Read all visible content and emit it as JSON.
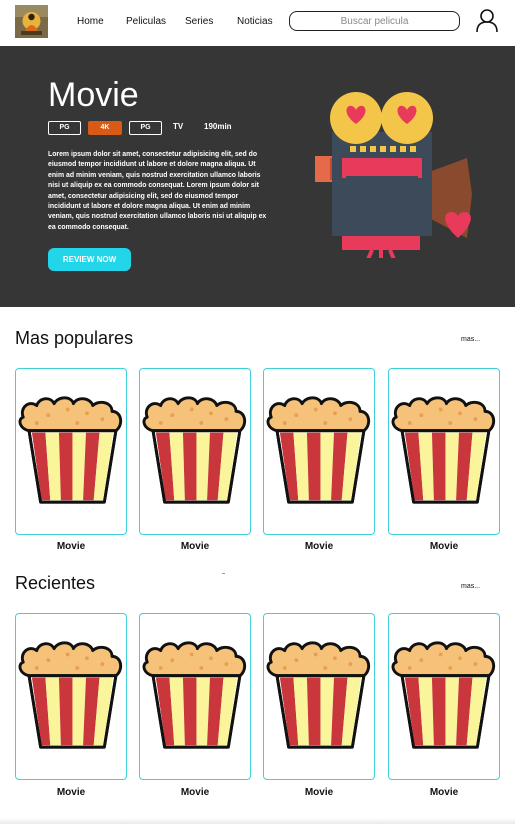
{
  "nav": {
    "links": [
      "Home",
      "Peliculas",
      "Series",
      "Noticias"
    ],
    "search_placeholder": "Buscar pelicula"
  },
  "hero": {
    "title": "Movie",
    "badges": [
      "PG",
      "4K",
      "PG"
    ],
    "type": "TV",
    "duration": "190min",
    "description": "Lorem ipsum dolor sit amet, consectetur adipisicing elit, sed do eiusmod tempor incididunt ut labore et dolore magna aliqua. Ut enim ad minim veniam, quis nostrud exercitation ullamco laboris nisi ut aliquip ex ea commodo consequat. Lorem ipsum dolor sit amet, consectetur adipisicing elit, sed do eiusmod tempor incididunt ut labore et dolore magna aliqua. Ut enim ad minim veniam, quis nostrud exercitation ullamco laboris nisi ut aliquip ex ea commodo consequat.",
    "review_button": "REVIEW NOW"
  },
  "popular": {
    "title": "Mas populares",
    "more": "mas...",
    "items": [
      "Movie",
      "Movie",
      "Movie",
      "Movie"
    ]
  },
  "recent": {
    "title": "Recientes",
    "more": "mas...",
    "items": [
      "Movie",
      "Movie",
      "Movie",
      "Movie"
    ]
  },
  "icons": {
    "logo": "buddha-logo-icon",
    "user": "user-icon",
    "camera": "movie-camera-icon",
    "poster": "popcorn-icon"
  },
  "colors": {
    "accent": "#22d5e8",
    "hero_bg": "#363636",
    "badge_orange": "#d95a14",
    "card_border": "#3fd0dc"
  }
}
